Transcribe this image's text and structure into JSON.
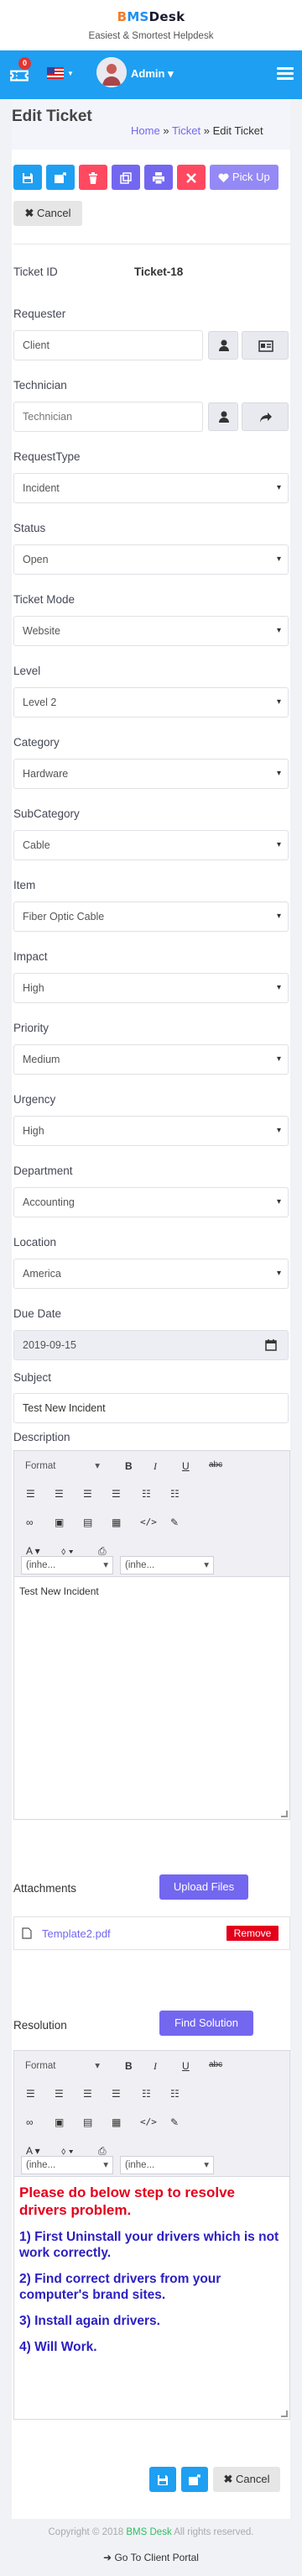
{
  "brand": {
    "part1": "B",
    "part2": "MS",
    "part3": "Desk",
    "tagline": "Easiest & Smortest Helpdesk"
  },
  "nav": {
    "notif_count": "0",
    "user": "Admin"
  },
  "page": {
    "title": "Edit Ticket",
    "crumb_home": "Home",
    "crumb_ticket": "Ticket",
    "crumb_current": "Edit Ticket",
    "sep": "»"
  },
  "toolbar": {
    "pickup": "Pick Up",
    "cancel": "Cancel"
  },
  "ticket_id": {
    "label": "Ticket ID",
    "value": "Ticket-18"
  },
  "fields": {
    "requester": {
      "label": "Requester",
      "value": "Client"
    },
    "technician": {
      "label": "Technician",
      "placeholder": "Technician"
    },
    "requesttype": {
      "label": "RequestType",
      "value": "Incident"
    },
    "status": {
      "label": "Status",
      "value": "Open"
    },
    "ticketmode": {
      "label": "Ticket Mode",
      "value": "Website"
    },
    "level": {
      "label": "Level",
      "value": "Level 2"
    },
    "category": {
      "label": "Category",
      "value": "Hardware"
    },
    "subcategory": {
      "label": "SubCategory",
      "value": "Cable"
    },
    "item": {
      "label": "Item",
      "value": "Fiber Optic Cable"
    },
    "impact": {
      "label": "Impact",
      "value": "High"
    },
    "priority": {
      "label": "Priority",
      "value": "Medium"
    },
    "urgency": {
      "label": "Urgency",
      "value": "High"
    },
    "department": {
      "label": "Department",
      "value": "Accounting"
    },
    "location": {
      "label": "Location",
      "value": "America"
    },
    "duedate": {
      "label": "Due Date",
      "value": "2019-09-15"
    },
    "subject": {
      "label": "Subject",
      "value": "Test New Incident"
    },
    "description": {
      "label": "Description",
      "value": "Test New Incident"
    }
  },
  "editor": {
    "format": "Format",
    "font": "(inhe...",
    "size": "(inhe..."
  },
  "attachments": {
    "label": "Attachments",
    "upload": "Upload Files",
    "file": "Template2.pdf",
    "remove": "Remove"
  },
  "resolution": {
    "label": "Resolution",
    "find": "Find Solution",
    "heading": "Please do below step to resolve drivers problem.",
    "steps": [
      "1) First Uninstall your drivers which is not work correctly.",
      "2) Find correct drivers from your computer's brand sites.",
      "3) Install again drivers.",
      "4) Will Work."
    ]
  },
  "bottom": {
    "cancel": "Cancel"
  },
  "footer": {
    "copy_pre": "Copyright © 2018",
    "copy_brand": "BMS Desk",
    "copy_post": "All rights reserved.",
    "portal": "Go To Client Portal"
  },
  "colors": {
    "primary": "#1e9ff2",
    "purple": "#7367f0",
    "danger": "#ff4961",
    "resolution_red": "#e3001b",
    "resolution_blue": "#2b1fc2"
  }
}
